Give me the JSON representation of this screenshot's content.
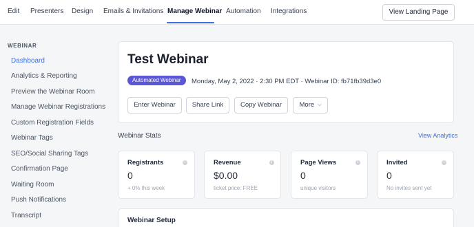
{
  "top_nav": {
    "tabs": [
      "Edit",
      "Presenters",
      "Design",
      "Emails & Invitations",
      "Manage Webinar",
      "Automation",
      "Integrations"
    ],
    "active_tab": "Manage Webinar",
    "view_landing_label": "View Landing Page"
  },
  "sidebar": {
    "heading": "WEBINAR",
    "items": [
      "Dashboard",
      "Analytics & Reporting",
      "Preview the Webinar Room",
      "Manage Webinar Registrations",
      "Custom Registration Fields",
      "Webinar Tags",
      "SEO/Social Sharing Tags",
      "Confirmation Page",
      "Waiting Room",
      "Push Notifications",
      "Transcript"
    ],
    "active_item": "Dashboard"
  },
  "header": {
    "title": "Test Webinar",
    "badge": "Automated Webinar",
    "meta": "Monday, May 2, 2022 · 2:30 PM EDT · Webinar ID: fb71fb39d3e0",
    "buttons": {
      "enter": "Enter Webinar",
      "share": "Share Link",
      "copy": "Copy Webinar",
      "more": "More"
    }
  },
  "stats": {
    "section_title": "Webinar Stats",
    "view_analytics": "View Analytics",
    "cards": [
      {
        "label": "Registrants",
        "value": "0",
        "sub": "+ 0% this week"
      },
      {
        "label": "Revenue",
        "value": "$0.00",
        "sub": "ticket price: FREE"
      },
      {
        "label": "Page Views",
        "value": "0",
        "sub": "unique visitors"
      },
      {
        "label": "Invited",
        "value": "0",
        "sub": "No invites sent yet"
      }
    ]
  },
  "setup": {
    "title": "Webinar Setup"
  },
  "colors": {
    "accent": "#3b6fe0",
    "badge": "#5b56d6"
  }
}
